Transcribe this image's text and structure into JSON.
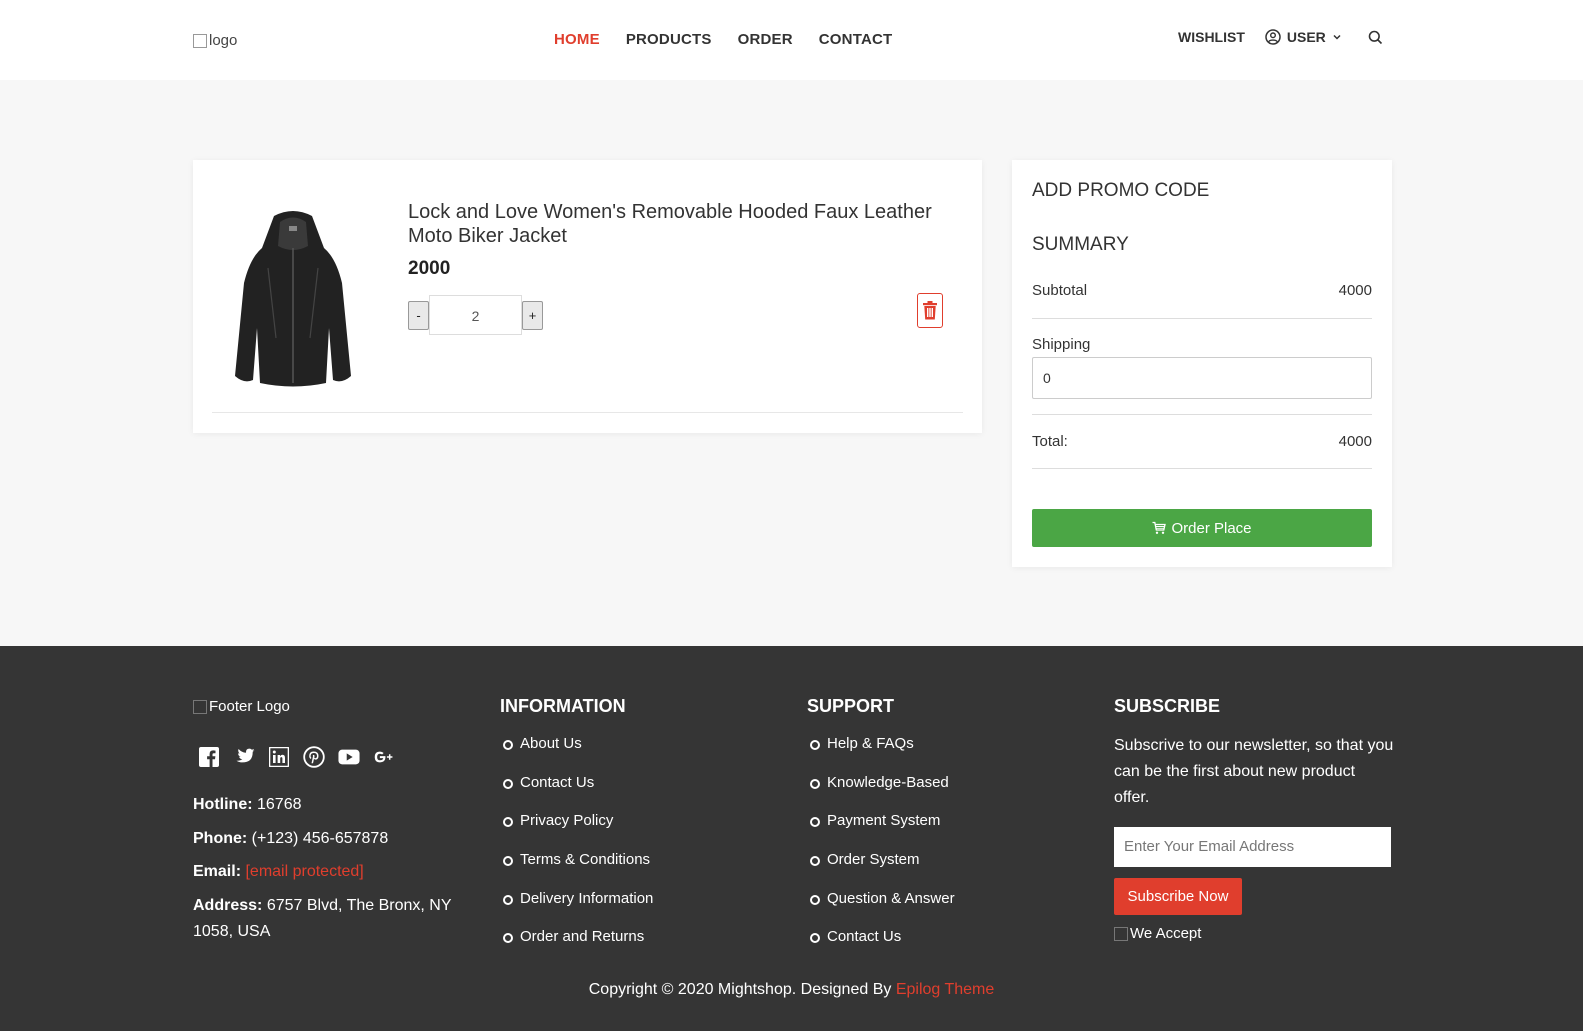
{
  "header": {
    "logo_alt": "logo",
    "nav": [
      {
        "label": "HOME",
        "active": true
      },
      {
        "label": "PRODUCTS",
        "active": false
      },
      {
        "label": "ORDER",
        "active": false
      },
      {
        "label": "CONTACT",
        "active": false
      }
    ],
    "wishlist_label": "WISHLIST",
    "user_label": "USER",
    "icons": [
      "user-circle-icon",
      "chevron-down-icon",
      "search-icon"
    ]
  },
  "cart": {
    "items": [
      {
        "title": "Lock and Love Women's Removable Hooded Faux Leather Moto Biker Jacket",
        "price": "2000",
        "quantity": "2",
        "minus_label": "-",
        "plus_label": "+"
      }
    ]
  },
  "summary": {
    "promo_title": "ADD PROMO CODE",
    "summary_title": "SUMMARY",
    "subtotal_label": "Subtotal",
    "subtotal_value": "4000",
    "shipping_label": "Shipping",
    "shipping_value": "0",
    "total_label": "Total:",
    "total_value": "4000",
    "order_button": "Order Place"
  },
  "footer": {
    "logo_alt": "Footer Logo",
    "socials": [
      "facebook-icon",
      "twitter-icon",
      "linkedin-icon",
      "pinterest-icon",
      "youtube-icon",
      "google-plus-icon"
    ],
    "hotline_label": "Hotline:",
    "hotline_value": "16768",
    "phone_label": "Phone:",
    "phone_value": "(+123) 456-657878",
    "email_label": "Email:",
    "email_value": "[email protected]",
    "address_label": "Address:",
    "address_value": "6757 Blvd, The Bronx, NY 1058, USA",
    "information_title": "INFORMATION",
    "information_links": [
      "About Us",
      "Contact Us",
      "Privacy Policy",
      "Terms & Conditions",
      "Delivery Information",
      "Order and Returns"
    ],
    "support_title": "SUPPORT",
    "support_links": [
      "Help & FAQs",
      "Knowledge-Based",
      "Payment System",
      "Order System",
      "Question & Answer",
      "Contact Us"
    ],
    "subscribe_title": "SUBSCRIBE",
    "subscribe_text": "Subscrive to our newsletter, so that you can be the first about new product offer.",
    "email_placeholder": "Enter Your Email Address",
    "subscribe_button": "Subscribe Now",
    "we_accept_alt": "We Accept",
    "copyright_text": "Copyright © 2020 Mightshop. Designed By ",
    "copyright_link": "Epilog Theme"
  },
  "colors": {
    "accent_red": "#e03e2d",
    "order_green": "#4ba645",
    "footer_bg": "#353535"
  }
}
